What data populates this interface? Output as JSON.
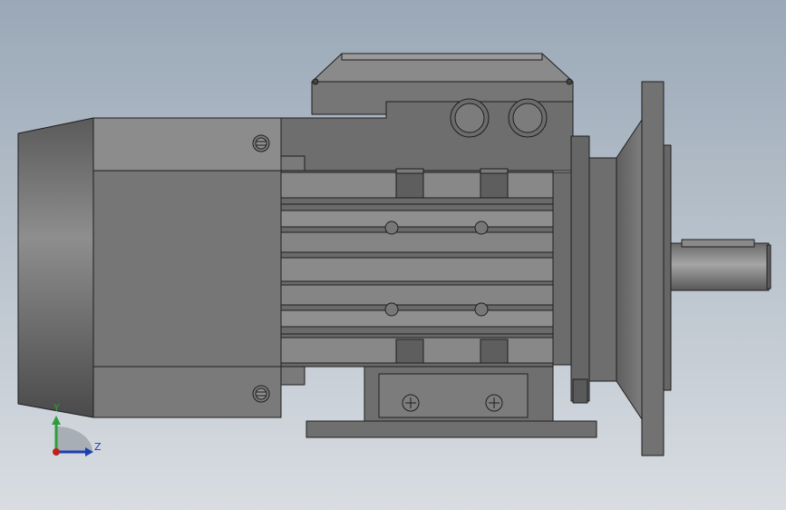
{
  "scene": {
    "model": "motor-assembly",
    "background": {
      "top": "#9aa8b7",
      "bottom": "#d9dde2"
    },
    "colors": {
      "edge": "#1f1f1f",
      "body_light": "#8a8a8a",
      "body_mid": "#6f6f6f",
      "body_dark": "#4f4f4f",
      "shadow": "#3d3d3d"
    }
  },
  "axis_triad": {
    "y_label": "Y",
    "z_label": "Z",
    "colors": {
      "y": "#2e9e3a",
      "z": "#1f3fb0",
      "x": "#c0201c"
    }
  }
}
